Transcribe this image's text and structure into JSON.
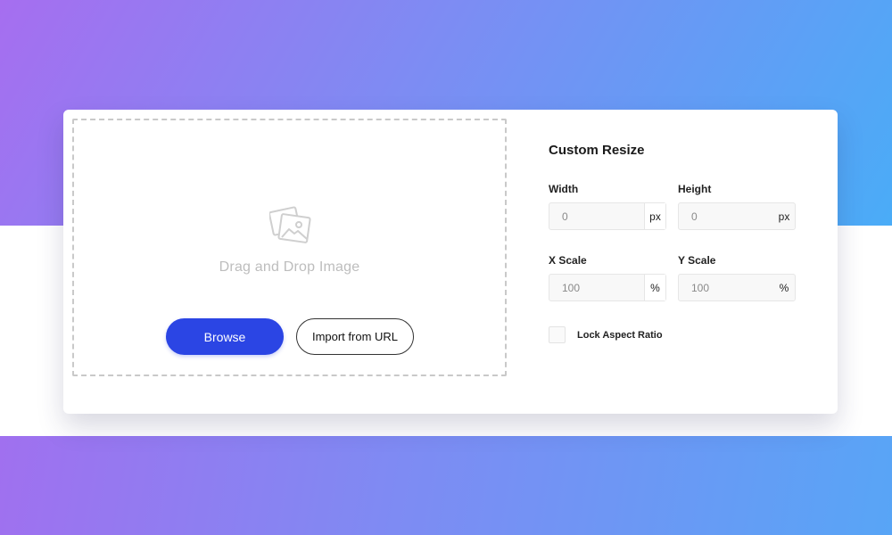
{
  "upload": {
    "prompt": "Drag and Drop Image",
    "icon": "image-icon",
    "browse_label": "Browse",
    "import_label": "Import from URL"
  },
  "resize": {
    "title": "Custom Resize",
    "width": {
      "label": "Width",
      "value": "0",
      "unit": "px"
    },
    "height": {
      "label": "Height",
      "value": "0",
      "unit": "px"
    },
    "x_scale": {
      "label": "X Scale",
      "value": "100",
      "unit": "%"
    },
    "y_scale": {
      "label": "Y Scale",
      "value": "100",
      "unit": "%"
    },
    "lock_label": "Lock Aspect Ratio",
    "lock_checked": false
  },
  "colors": {
    "accent": "#2b45e4",
    "gradient_start": "#a66ef0",
    "gradient_end": "#4aacf7"
  }
}
